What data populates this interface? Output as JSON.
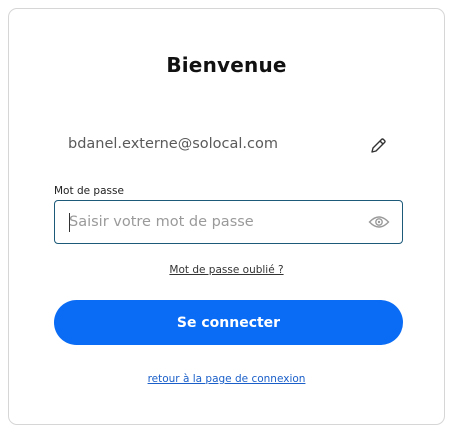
{
  "page": {
    "title": "Bienvenue"
  },
  "account": {
    "email": "bdanel.externe@solocal.com",
    "edit_icon": "pencil-icon"
  },
  "password": {
    "label": "Mot de passe",
    "placeholder": "Saisir votre mot de passe",
    "value": "",
    "toggle_icon": "eye-icon"
  },
  "links": {
    "forgot_password": "Mot de passe oublié ?",
    "back_to_login": "retour à la page de connexion"
  },
  "actions": {
    "login_label": "Se connecter"
  },
  "colors": {
    "primary": "#0a6cf5",
    "field_border": "#1d5a7a",
    "link": "#1a5fc9"
  }
}
